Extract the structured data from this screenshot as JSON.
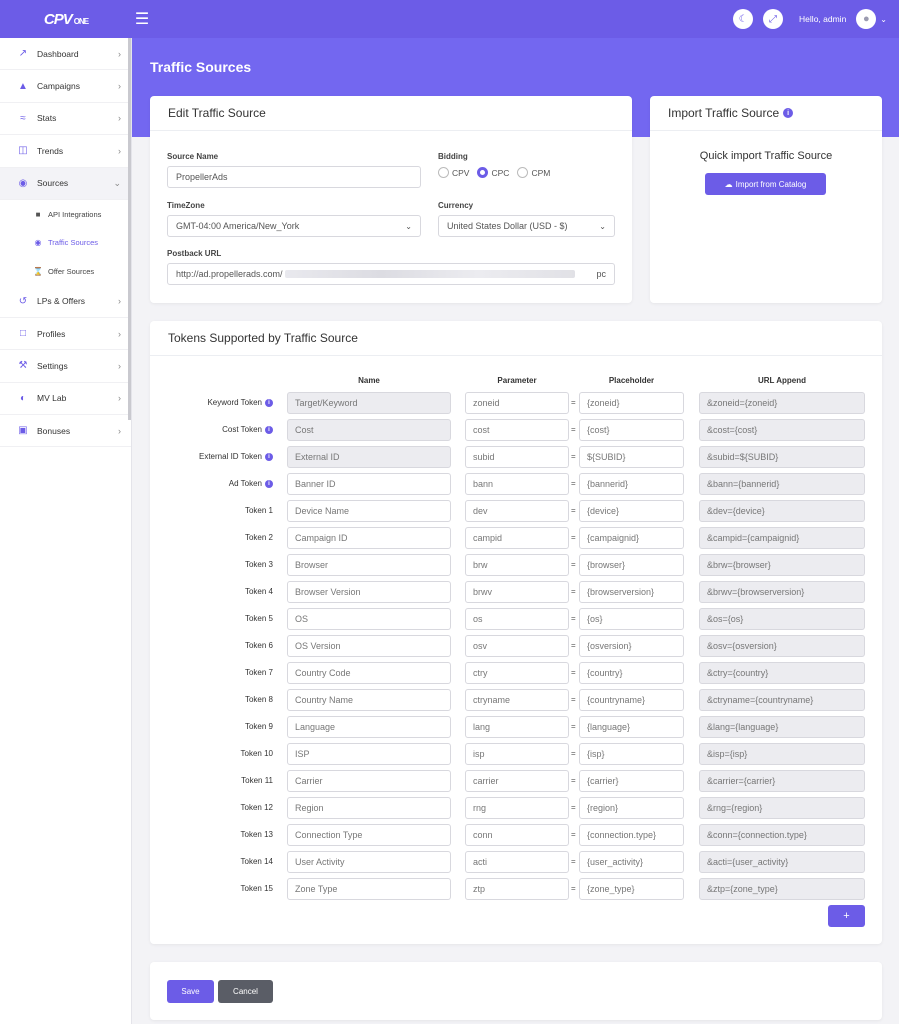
{
  "brand": {
    "logo": "CPV",
    "sub": "ONE"
  },
  "topbar": {
    "greeting": "Hello, admin"
  },
  "sidebar": {
    "items": [
      {
        "label": "Dashboard",
        "icon": "chart-line-icon"
      },
      {
        "label": "Campaigns",
        "icon": "flask-icon"
      },
      {
        "label": "Stats",
        "icon": "stats-icon"
      },
      {
        "label": "Trends",
        "icon": "columns-icon"
      },
      {
        "label": "Sources",
        "icon": "globe-icon"
      },
      {
        "label": "LPs & Offers",
        "icon": "refresh-icon"
      },
      {
        "label": "Profiles",
        "icon": "clipboard-icon"
      },
      {
        "label": "Settings",
        "icon": "wrench-icon"
      },
      {
        "label": "MV Lab",
        "icon": "mv-lab-icon"
      },
      {
        "label": "Bonuses",
        "icon": "gift-icon"
      }
    ],
    "sources_sub": [
      {
        "label": "API Integrations",
        "icon": "folder-icon"
      },
      {
        "label": "Traffic Sources",
        "icon": "globe-icon"
      },
      {
        "label": "Offer Sources",
        "icon": "cart-icon"
      }
    ]
  },
  "page": {
    "title": "Traffic Sources"
  },
  "edit": {
    "title": "Edit Traffic Source",
    "source_name_label": "Source Name",
    "source_name_value": "PropellerAds",
    "bidding_label": "Bidding",
    "bidding_options": [
      "CPV",
      "CPC",
      "CPM"
    ],
    "bidding_selected": "CPC",
    "timezone_label": "TimeZone",
    "timezone_value": "GMT-04:00 America/New_York",
    "currency_label": "Currency",
    "currency_value": "United States Dollar (USD - $)",
    "postback_label": "Postback URL",
    "postback_start": "http://ad.propellerads.com/",
    "postback_end": "pc"
  },
  "import": {
    "title": "Import Traffic Source",
    "subtitle": "Quick import Traffic Source",
    "button": "Import from Catalog"
  },
  "tokens": {
    "title": "Tokens Supported by Traffic Source",
    "headers": {
      "name": "Name",
      "parameter": "Parameter",
      "placeholder": "Placeholder",
      "url_append": "URL Append"
    },
    "rows": [
      {
        "label": "Keyword Token",
        "info": true,
        "name": "Target/Keyword",
        "name_ro": true,
        "param": "zoneid",
        "placeholder": "{zoneid}",
        "append": "&zoneid={zoneid}"
      },
      {
        "label": "Cost Token",
        "info": true,
        "name": "Cost",
        "name_ro": true,
        "param": "cost",
        "placeholder": "{cost}",
        "append": "&cost={cost}"
      },
      {
        "label": "External ID Token",
        "info": true,
        "name": "External ID",
        "name_ro": true,
        "param": "subid",
        "placeholder": "${SUBID}",
        "append": "&subid=${SUBID}"
      },
      {
        "label": "Ad Token",
        "info": true,
        "name": "Banner ID",
        "name_ro": false,
        "param": "bann",
        "placeholder": "{bannerid}",
        "append": "&bann={bannerid}"
      },
      {
        "label": "Token 1",
        "info": false,
        "name": "Device Name",
        "name_ro": false,
        "param": "dev",
        "placeholder": "{device}",
        "append": "&dev={device}"
      },
      {
        "label": "Token 2",
        "info": false,
        "name": "Campaign ID",
        "name_ro": false,
        "param": "campid",
        "placeholder": "{campaignid}",
        "append": "&campid={campaignid}"
      },
      {
        "label": "Token 3",
        "info": false,
        "name": "Browser",
        "name_ro": false,
        "param": "brw",
        "placeholder": "{browser}",
        "append": "&brw={browser}"
      },
      {
        "label": "Token 4",
        "info": false,
        "name": "Browser Version",
        "name_ro": false,
        "param": "brwv",
        "placeholder": "{browserversion}",
        "append": "&brwv={browserversion}"
      },
      {
        "label": "Token 5",
        "info": false,
        "name": "OS",
        "name_ro": false,
        "param": "os",
        "placeholder": "{os}",
        "append": "&os={os}"
      },
      {
        "label": "Token 6",
        "info": false,
        "name": "OS Version",
        "name_ro": false,
        "param": "osv",
        "placeholder": "{osversion}",
        "append": "&osv={osversion}"
      },
      {
        "label": "Token 7",
        "info": false,
        "name": "Country Code",
        "name_ro": false,
        "param": "ctry",
        "placeholder": "{country}",
        "append": "&ctry={country}"
      },
      {
        "label": "Token 8",
        "info": false,
        "name": "Country Name",
        "name_ro": false,
        "param": "ctryname",
        "placeholder": "{countryname}",
        "append": "&ctryname={countryname}"
      },
      {
        "label": "Token 9",
        "info": false,
        "name": "Language",
        "name_ro": false,
        "param": "lang",
        "placeholder": "{language}",
        "append": "&lang={language}"
      },
      {
        "label": "Token 10",
        "info": false,
        "name": "ISP",
        "name_ro": false,
        "param": "isp",
        "placeholder": "{isp}",
        "append": "&isp={isp}"
      },
      {
        "label": "Token 11",
        "info": false,
        "name": "Carrier",
        "name_ro": false,
        "param": "carrier",
        "placeholder": "{carrier}",
        "append": "&carrier={carrier}"
      },
      {
        "label": "Token 12",
        "info": false,
        "name": "Region",
        "name_ro": false,
        "param": "rng",
        "placeholder": "{region}",
        "append": "&rng={region}"
      },
      {
        "label": "Token 13",
        "info": false,
        "name": "Connection Type",
        "name_ro": false,
        "param": "conn",
        "placeholder": "{connection.type}",
        "append": "&conn={connection.type}"
      },
      {
        "label": "Token 14",
        "info": false,
        "name": "User Activity",
        "name_ro": false,
        "param": "acti",
        "placeholder": "{user_activity}",
        "append": "&acti={user_activity}"
      },
      {
        "label": "Token 15",
        "info": false,
        "name": "Zone Type",
        "name_ro": false,
        "param": "ztp",
        "placeholder": "{zone_type}",
        "append": "&ztp={zone_type}"
      }
    ],
    "add_button": "+"
  },
  "footer": {
    "save": "Save",
    "cancel": "Cancel"
  },
  "colors": {
    "accent": "#6c5ce7",
    "band": "#7367f0",
    "gray_button": "#5a5d66"
  }
}
